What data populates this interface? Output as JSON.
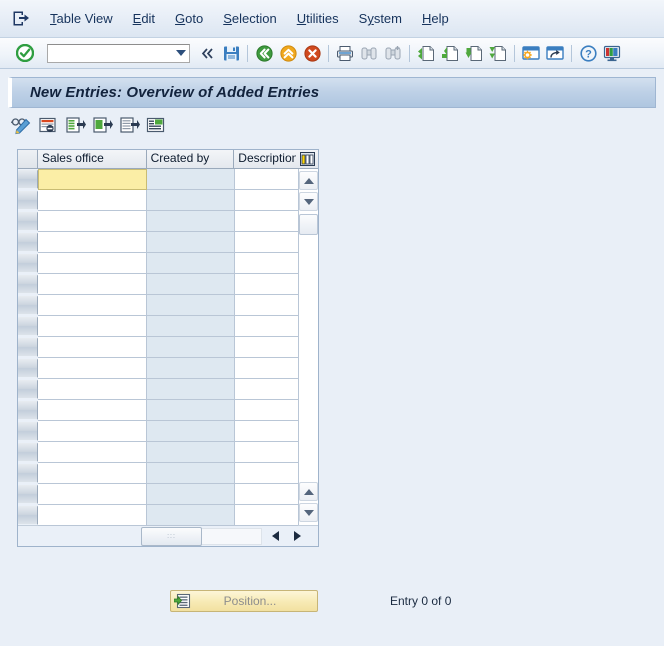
{
  "window": {
    "system_icon": "exit-window-icon"
  },
  "menubar": {
    "items": [
      {
        "label": "Table View",
        "accel_index": 0,
        "name": "menu-table-view"
      },
      {
        "label": "Edit",
        "accel_index": 0,
        "name": "menu-edit"
      },
      {
        "label": "Goto",
        "accel_index": 0,
        "name": "menu-goto"
      },
      {
        "label": "Selection",
        "accel_index": 0,
        "name": "menu-selection"
      },
      {
        "label": "Utilities",
        "accel_index": 0,
        "name": "menu-utilities"
      },
      {
        "label": "System",
        "accel_index": 1,
        "name": "menu-system"
      },
      {
        "label": "Help",
        "accel_index": 0,
        "name": "menu-help"
      }
    ]
  },
  "toolbar": {
    "ok_icon": "green-check-enter-icon",
    "command_field_value": "",
    "command_field_placeholder": "",
    "dropdown_icon": "chevron-down-icon",
    "history_icon": "double-chevron-left-icon",
    "buttons": [
      {
        "name": "save-button",
        "icon": "save-floppy-icon",
        "tooltip": "Save"
      },
      {
        "name": "back-button",
        "icon": "green-back-arrow-icon",
        "tooltip": "Back"
      },
      {
        "name": "exit-button",
        "icon": "yellow-exit-up-arrow-icon",
        "tooltip": "Exit"
      },
      {
        "name": "cancel-button",
        "icon": "red-cancel-x-icon",
        "tooltip": "Cancel"
      },
      {
        "name": "print-button",
        "icon": "printer-icon",
        "tooltip": "Print"
      },
      {
        "name": "find-button",
        "icon": "binoculars-icon",
        "tooltip": "Find"
      },
      {
        "name": "find-next-button",
        "icon": "binoculars-plus-icon",
        "tooltip": "Find Next"
      },
      {
        "name": "first-page-button",
        "icon": "page-first-icon",
        "tooltip": "First Page"
      },
      {
        "name": "previous-page-button",
        "icon": "page-up-icon",
        "tooltip": "Previous Page"
      },
      {
        "name": "next-page-button",
        "icon": "page-down-icon",
        "tooltip": "Next Page"
      },
      {
        "name": "last-page-button",
        "icon": "page-last-icon",
        "tooltip": "Last Page"
      },
      {
        "name": "create-session-button",
        "icon": "new-session-icon",
        "tooltip": "Create New Session"
      },
      {
        "name": "create-shortcut-button",
        "icon": "shortcut-icon",
        "tooltip": "Create Shortcut"
      },
      {
        "name": "help-button",
        "icon": "question-help-icon",
        "tooltip": "Help"
      },
      {
        "name": "customize-layout-button",
        "icon": "layout-menu-icon",
        "tooltip": "Customizing of Local Layout"
      }
    ]
  },
  "title": {
    "text": "New Entries: Overview of Added Entries"
  },
  "apptoolbar": {
    "buttons": [
      {
        "name": "display-change-button",
        "icon": "glasses-pencil-icon",
        "tooltip": "Display/Change"
      },
      {
        "name": "new-entries-button",
        "icon": "new-entries-icon",
        "tooltip": "New Entries"
      },
      {
        "name": "copy-as-button",
        "icon": "copy-as-icon",
        "tooltip": "Copy As..."
      },
      {
        "name": "delete-button",
        "icon": "delete-row-icon",
        "tooltip": "Delete"
      },
      {
        "name": "undo-button",
        "icon": "undo-change-icon",
        "tooltip": "Undo Change"
      },
      {
        "name": "select-all-button",
        "icon": "select-block-icon",
        "tooltip": "Select Block"
      }
    ]
  },
  "table": {
    "columns": [
      {
        "label": "Sales office",
        "name": "column-sales-office"
      },
      {
        "label": "Created by",
        "name": "column-created-by"
      },
      {
        "label": "Description",
        "name": "column-description"
      }
    ],
    "config_icon": "column-configuration-icon",
    "row_count": 17,
    "rows": [
      {
        "sales_office": "",
        "created_by": "",
        "description": "",
        "active": true
      },
      {
        "sales_office": "",
        "created_by": "",
        "description": ""
      },
      {
        "sales_office": "",
        "created_by": "",
        "description": ""
      },
      {
        "sales_office": "",
        "created_by": "",
        "description": ""
      },
      {
        "sales_office": "",
        "created_by": "",
        "description": ""
      },
      {
        "sales_office": "",
        "created_by": "",
        "description": ""
      },
      {
        "sales_office": "",
        "created_by": "",
        "description": ""
      },
      {
        "sales_office": "",
        "created_by": "",
        "description": ""
      },
      {
        "sales_office": "",
        "created_by": "",
        "description": ""
      },
      {
        "sales_office": "",
        "created_by": "",
        "description": ""
      },
      {
        "sales_office": "",
        "created_by": "",
        "description": ""
      },
      {
        "sales_office": "",
        "created_by": "",
        "description": ""
      },
      {
        "sales_office": "",
        "created_by": "",
        "description": ""
      },
      {
        "sales_office": "",
        "created_by": "",
        "description": ""
      },
      {
        "sales_office": "",
        "created_by": "",
        "description": ""
      },
      {
        "sales_office": "",
        "created_by": "",
        "description": ""
      },
      {
        "sales_office": "",
        "created_by": "",
        "description": ""
      }
    ],
    "vertical_scrollbar": {
      "up_icon": "scroll-up-arrow-icon",
      "down_icon": "scroll-down-arrow-icon",
      "bottom_up_icon": "scroll-page-up-arrow-icon",
      "bottom_down_icon": "scroll-page-down-arrow-icon"
    },
    "horizontal_scrollbar": {
      "left_icon": "scroll-left-arrow-icon",
      "right_icon": "scroll-right-arrow-icon"
    }
  },
  "footer": {
    "position_button_label": "Position...",
    "position_button_icon": "position-goto-icon",
    "entry_status": "Entry 0 of 0"
  },
  "colors": {
    "page_background": "#e9eff7",
    "title_bar": "#bdd0e6",
    "active_cell": "#fbeea6",
    "active_cell_marker": "#e2001a",
    "created_by_column": "#dee8f1",
    "menu_text": "#16335c",
    "position_button": "#f7eab4"
  }
}
